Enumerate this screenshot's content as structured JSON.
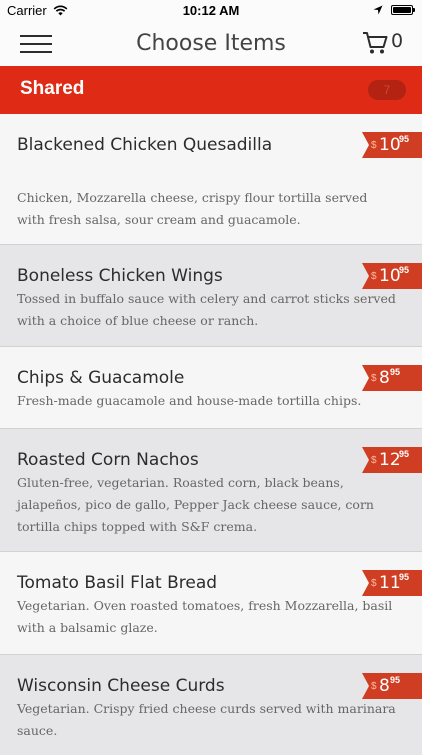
{
  "status_bar": {
    "carrier": "Carrier",
    "time": "10:12 AM"
  },
  "nav": {
    "title": "Choose Items",
    "cart_count": "0"
  },
  "section": {
    "title": "Shared",
    "count": "7"
  },
  "items": [
    {
      "name": "Blackened Chicken Quesadilla",
      "price_dollars": "10",
      "price_cents": "95",
      "description": "Chicken, Mozzarella cheese, crispy flour tortilla served with fresh salsa, sour cream and guacamole."
    },
    {
      "name": "Boneless Chicken Wings",
      "price_dollars": "10",
      "price_cents": "95",
      "description": "Tossed in buffalo sauce with celery and carrot sticks served with a choice of blue cheese or ranch."
    },
    {
      "name": "Chips & Guacamole",
      "price_dollars": "8",
      "price_cents": "95",
      "description": "Fresh-made guacamole and house-made tortilla chips."
    },
    {
      "name": "Roasted Corn Nachos",
      "price_dollars": "12",
      "price_cents": "95",
      "description": "Gluten-free, vegetarian. Roasted corn, black beans, jalapeños, pico de gallo, Pepper Jack cheese sauce, corn tortilla chips topped with S&F crema."
    },
    {
      "name": "Tomato Basil Flat Bread",
      "price_dollars": "11",
      "price_cents": "95",
      "description": "Vegetarian. Oven roasted tomatoes, fresh Mozzarella, basil with a balsamic glaze."
    },
    {
      "name": "Wisconsin Cheese Curds",
      "price_dollars": "8",
      "price_cents": "95",
      "description": "Vegetarian. Crispy fried cheese curds served with marinara sauce."
    }
  ],
  "currency_symbol": "$",
  "colors": {
    "accent": "#df2a16",
    "price_tag": "#cf3d22"
  }
}
